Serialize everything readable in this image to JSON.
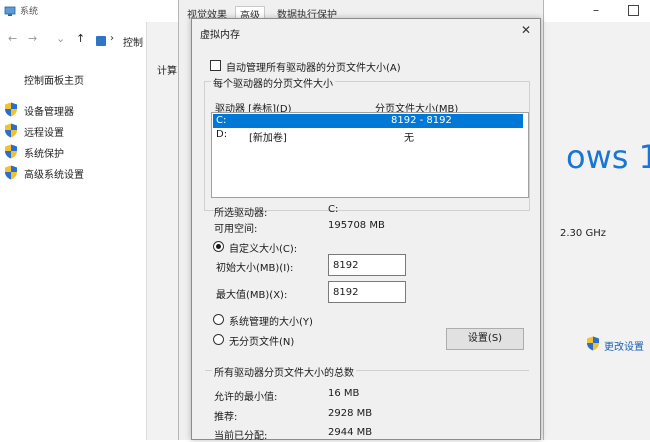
{
  "system_window": {
    "title": "系统",
    "breadcrumb": "控制",
    "content_label": "计算",
    "sidebar_home": "控制面板主页",
    "sidebar_items": [
      {
        "label": "设备管理器",
        "icon": "shield-icon"
      },
      {
        "label": "远程设置",
        "icon": "shield-icon"
      },
      {
        "label": "系统保护",
        "icon": "shield-icon"
      },
      {
        "label": "高级系统设置",
        "icon": "shield-icon"
      }
    ],
    "windows_logo_text": "ows 1",
    "cpu_speed": "2.30 GHz",
    "change_settings": "更改设置"
  },
  "performance_dialog": {
    "tabs": [
      "视觉效果",
      "高级",
      "数据执行保护"
    ]
  },
  "virtual_memory": {
    "title": "虚拟内存",
    "auto_manage_label": "自动管理所有驱动器的分页文件大小(A)",
    "auto_manage_checked": false,
    "group_title": "每个驱动器的分页文件大小",
    "col_drive": "驱动器 [卷标](D)",
    "col_size": "分页文件大小(MB)",
    "drives": [
      {
        "drive": "C:",
        "label": "",
        "size": "8192 - 8192",
        "selected": true
      },
      {
        "drive": "D:",
        "label": "[新加卷]",
        "size": "无",
        "selected": false
      }
    ],
    "selected_drive_label": "所选驱动器:",
    "selected_drive_value": "C:",
    "free_space_label": "可用空间:",
    "free_space_value": "195708 MB",
    "custom_size_label": "自定义大小(C):",
    "initial_size_label": "初始大小(MB)(I):",
    "initial_size_value": "8192",
    "max_size_label": "最大值(MB)(X):",
    "max_size_value": "8192",
    "system_managed_label": "系统管理的大小(Y)",
    "no_paging_label": "无分页文件(N)",
    "set_button": "设置(S)",
    "total_group_title": "所有驱动器分页文件大小的总数",
    "min_allowed_label": "允许的最小值:",
    "min_allowed_value": "16 MB",
    "recommended_label": "推荐:",
    "recommended_value": "2928 MB",
    "current_label": "当前已分配:",
    "current_value": "2944 MB"
  },
  "colors": {
    "selection": "#0078d7",
    "dialog_bg": "#f0f0f0",
    "link": "#1a5fb4",
    "win_logo": "#1976d2"
  }
}
